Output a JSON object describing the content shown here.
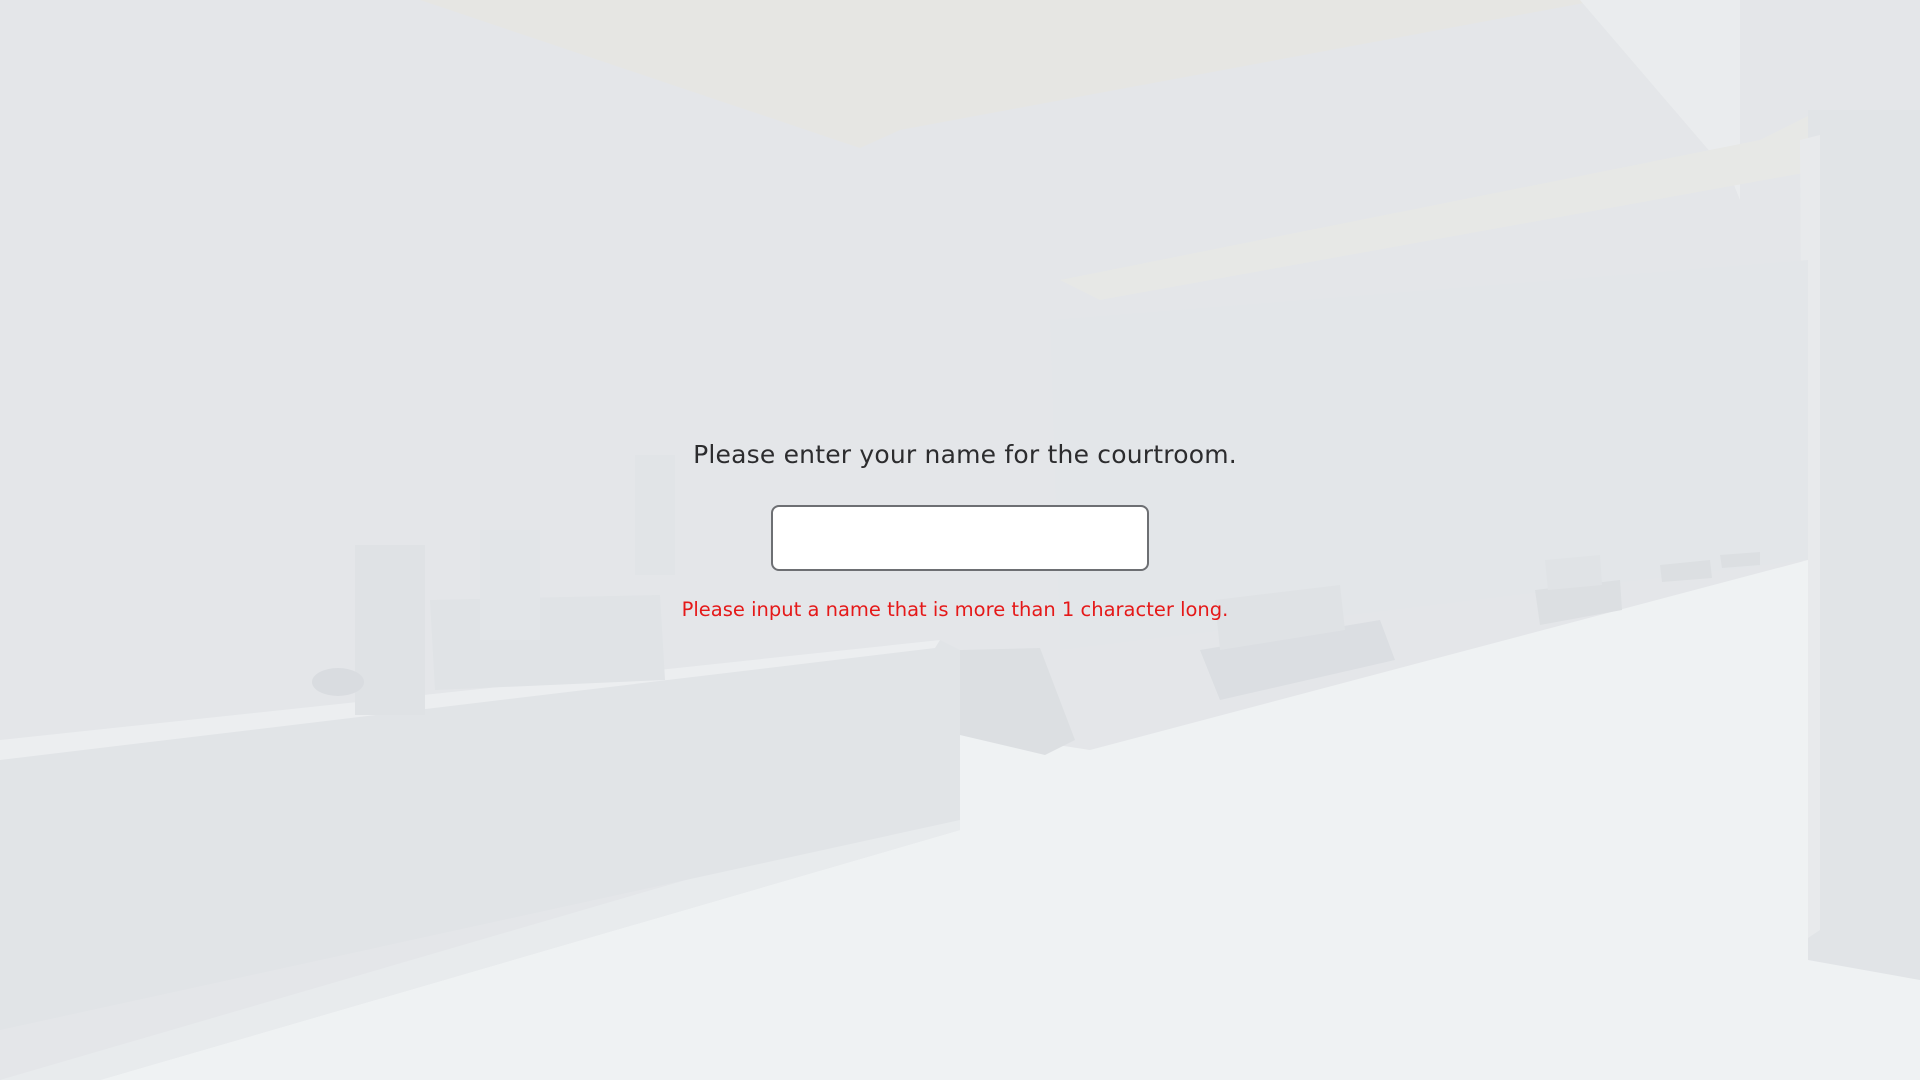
{
  "dialog": {
    "prompt": "Please enter your name for the courtroom.",
    "name_value": "",
    "error": "Please input a name that is more than 1 character long."
  },
  "colors": {
    "background": "#e4e6e9",
    "floor": "#eff2f3",
    "prompt_text": "#2c2c2e",
    "error_text": "#e51919",
    "input_border": "#6d6f73"
  }
}
